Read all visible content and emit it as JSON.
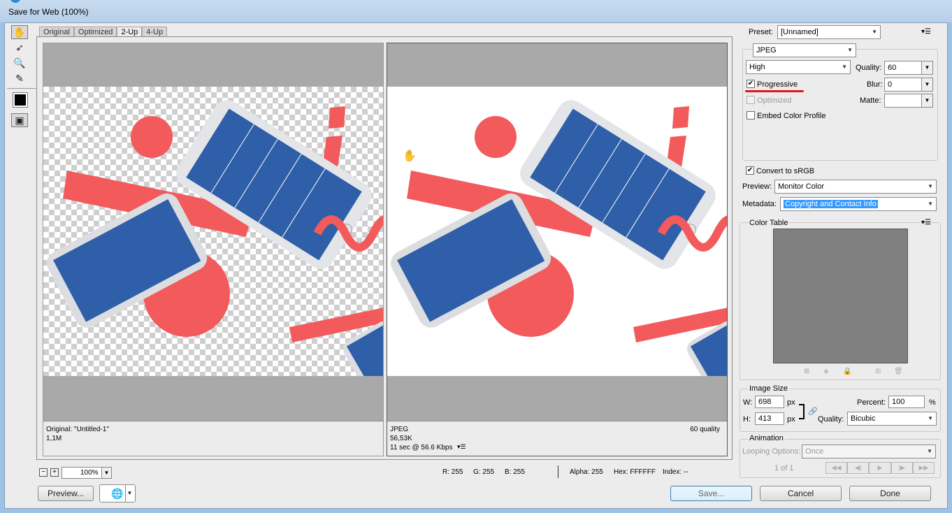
{
  "window": {
    "title": "Save for Web (100%)"
  },
  "tools": {
    "hand": "hand-tool-icon",
    "slice_select": "slice-select-icon",
    "zoom": "zoom-icon",
    "eyedropper": "eyedropper-icon",
    "preview_toggle": "toggle-slices-icon"
  },
  "tabs": [
    {
      "label": "Original",
      "active": false
    },
    {
      "label": "Optimized",
      "active": false
    },
    {
      "label": "2-Up",
      "active": true
    },
    {
      "label": "4-Up",
      "active": false
    }
  ],
  "panes": {
    "original": {
      "line1": "Original: \"Untitled-1\"",
      "line2": "1,1M"
    },
    "optimized": {
      "line1": "JPEG",
      "line2": "56,53K",
      "line3": "11 sec @ 56.6 Kbps",
      "quality": "60 quality"
    }
  },
  "zoom": {
    "minus": "−",
    "plus": "+",
    "value": "100%"
  },
  "status": {
    "r": "R: 255",
    "g": "G: 255",
    "b": "B: 255",
    "alpha": "Alpha: 255",
    "hex": "Hex: FFFFFF",
    "index": "Index: --"
  },
  "buttons": {
    "preview": "Preview...",
    "save": "Save...",
    "cancel": "Cancel",
    "done": "Done"
  },
  "settings": {
    "preset_label": "Preset:",
    "preset_value": "[Unnamed]",
    "format": "JPEG",
    "quality_preset": "High",
    "quality_label": "Quality:",
    "quality_value": "60",
    "progressive": {
      "label": "Progressive",
      "checked": true
    },
    "blur_label": "Blur:",
    "blur_value": "0",
    "optimized": {
      "label": "Optimized",
      "checked": false
    },
    "matte_label": "Matte:",
    "embed_profile": {
      "label": "Embed Color Profile",
      "checked": false
    },
    "convert_srgb": {
      "label": "Convert to sRGB",
      "checked": true
    },
    "preview_label": "Preview:",
    "preview_value": "Monitor Color",
    "metadata_label": "Metadata:",
    "metadata_value": "Copyright and Contact Info"
  },
  "color_table": {
    "title": "Color Table"
  },
  "image_size": {
    "title": "Image Size",
    "w_label": "W:",
    "w_value": "698",
    "w_unit": "px",
    "h_label": "H:",
    "h_value": "413",
    "h_unit": "px",
    "percent_label": "Percent:",
    "percent_value": "100",
    "percent_unit": "%",
    "quality_label": "Quality:",
    "quality_value": "Bicubic"
  },
  "animation": {
    "title": "Animation",
    "looping_label": "Looping Options:",
    "looping_value": "Once",
    "frame_counter": "1 of 1"
  },
  "colors": {
    "accent_red": "#f25a5c",
    "phone_blue": "#2f5fa8",
    "highlight": "#3399ff"
  }
}
